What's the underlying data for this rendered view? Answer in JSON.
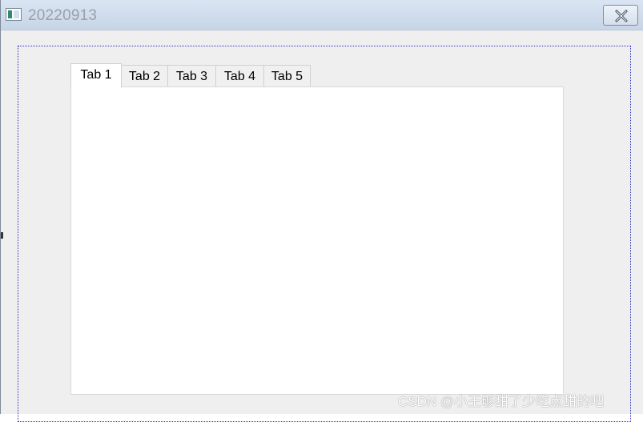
{
  "window": {
    "title": "20220913",
    "icon": "app-window-icon",
    "close_icon": "close-icon"
  },
  "tabs": [
    {
      "label": "Tab 1",
      "active": true
    },
    {
      "label": "Tab 2",
      "active": false
    },
    {
      "label": "Tab 3",
      "active": false
    },
    {
      "label": "Tab 4",
      "active": false
    },
    {
      "label": "Tab 5",
      "active": false
    }
  ],
  "watermark": "CSDN @小王够甜了少吃点甜的吧"
}
